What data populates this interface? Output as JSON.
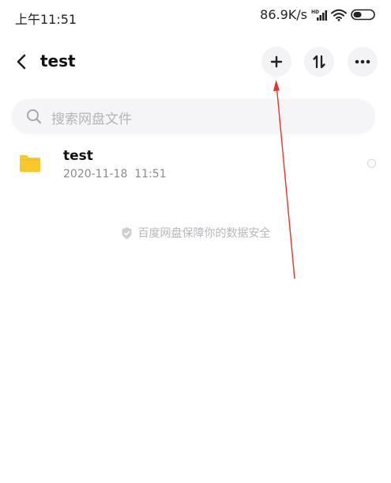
{
  "status_bar": {
    "time": "上午11:51",
    "net_speed": "86.9K/s"
  },
  "header": {
    "title": "test",
    "icons": {
      "back": "chevron-left-icon",
      "add": "plus-icon",
      "sort": "sort-icon",
      "more": "more-horizontal-icon"
    }
  },
  "search": {
    "placeholder": "搜索网盘文件"
  },
  "files": [
    {
      "name": "test",
      "date": "2020-11-18  11:51",
      "type": "folder"
    }
  ],
  "security_notice": "百度网盘保障你的数据安全",
  "colors": {
    "folder": "#F9C82E",
    "annotation_arrow": "#E8322D",
    "search_bg": "#F5F5F7",
    "button_bg": "#F3F3F5"
  }
}
